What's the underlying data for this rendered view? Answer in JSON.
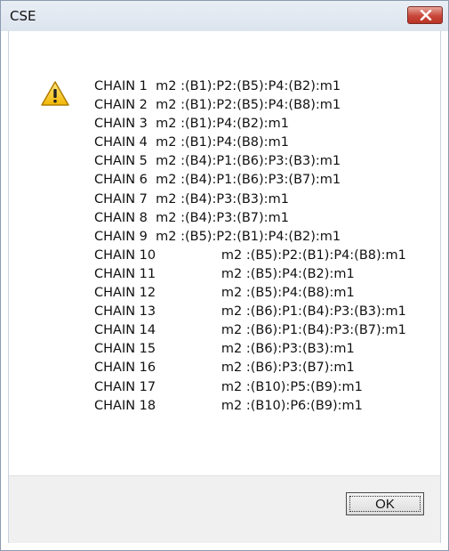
{
  "window": {
    "title": "CSE"
  },
  "icon": {
    "name": "warning-icon"
  },
  "lines": [
    "CHAIN 1  m2 :(B1):P2:(B5):P4:(B2):m1",
    "CHAIN 2  m2 :(B1):P2:(B5):P4:(B8):m1",
    "CHAIN 3  m2 :(B1):P4:(B2):m1",
    "CHAIN 4  m2 :(B1):P4:(B8):m1",
    "CHAIN 5  m2 :(B4):P1:(B6):P3:(B3):m1",
    "CHAIN 6  m2 :(B4):P1:(B6):P3:(B7):m1",
    "CHAIN 7  m2 :(B4):P3:(B3):m1",
    "CHAIN 8  m2 :(B4):P3:(B7):m1",
    "CHAIN 9  m2 :(B5):P2:(B1):P4:(B2):m1",
    "CHAIN 10                m2 :(B5):P2:(B1):P4:(B8):m1",
    "CHAIN 11                m2 :(B5):P4:(B2):m1",
    "CHAIN 12                m2 :(B5):P4:(B8):m1",
    "CHAIN 13                m2 :(B6):P1:(B4):P3:(B3):m1",
    "CHAIN 14                m2 :(B6):P1:(B4):P3:(B7):m1",
    "CHAIN 15                m2 :(B6):P3:(B3):m1",
    "CHAIN 16                m2 :(B6):P3:(B7):m1",
    "CHAIN 17                m2 :(B10):P5:(B9):m1",
    "CHAIN 18                m2 :(B10):P6:(B9):m1"
  ],
  "buttons": {
    "ok": "OK"
  }
}
